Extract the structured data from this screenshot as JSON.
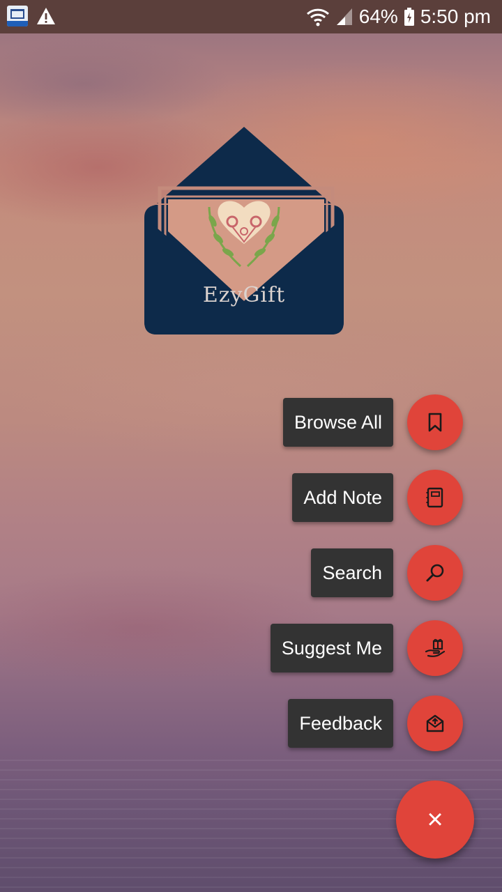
{
  "status_bar": {
    "battery": "64%",
    "time": "5:50 pm",
    "icons": [
      "app-notification-icon",
      "warning-icon",
      "wifi-icon",
      "signal-icon",
      "battery-icon"
    ]
  },
  "logo": {
    "text": "EzyGift",
    "colors": {
      "envelope": "#0d2a4a",
      "card": "#d49a86",
      "heart": "#f2dcc0",
      "leaf": "#7aa64b",
      "flower": "#c8656a"
    }
  },
  "speed_dial": {
    "items": [
      {
        "label": "Browse All",
        "icon": "bookmark-icon"
      },
      {
        "label": "Add Note",
        "icon": "notebook-icon"
      },
      {
        "label": "Search",
        "icon": "search-icon"
      },
      {
        "label": "Suggest Me",
        "icon": "gift-hand-icon"
      },
      {
        "label": "Feedback",
        "icon": "mail-open-icon"
      }
    ],
    "close_icon": "×",
    "accent_color": "#e0443a",
    "label_bg": "#333333"
  }
}
